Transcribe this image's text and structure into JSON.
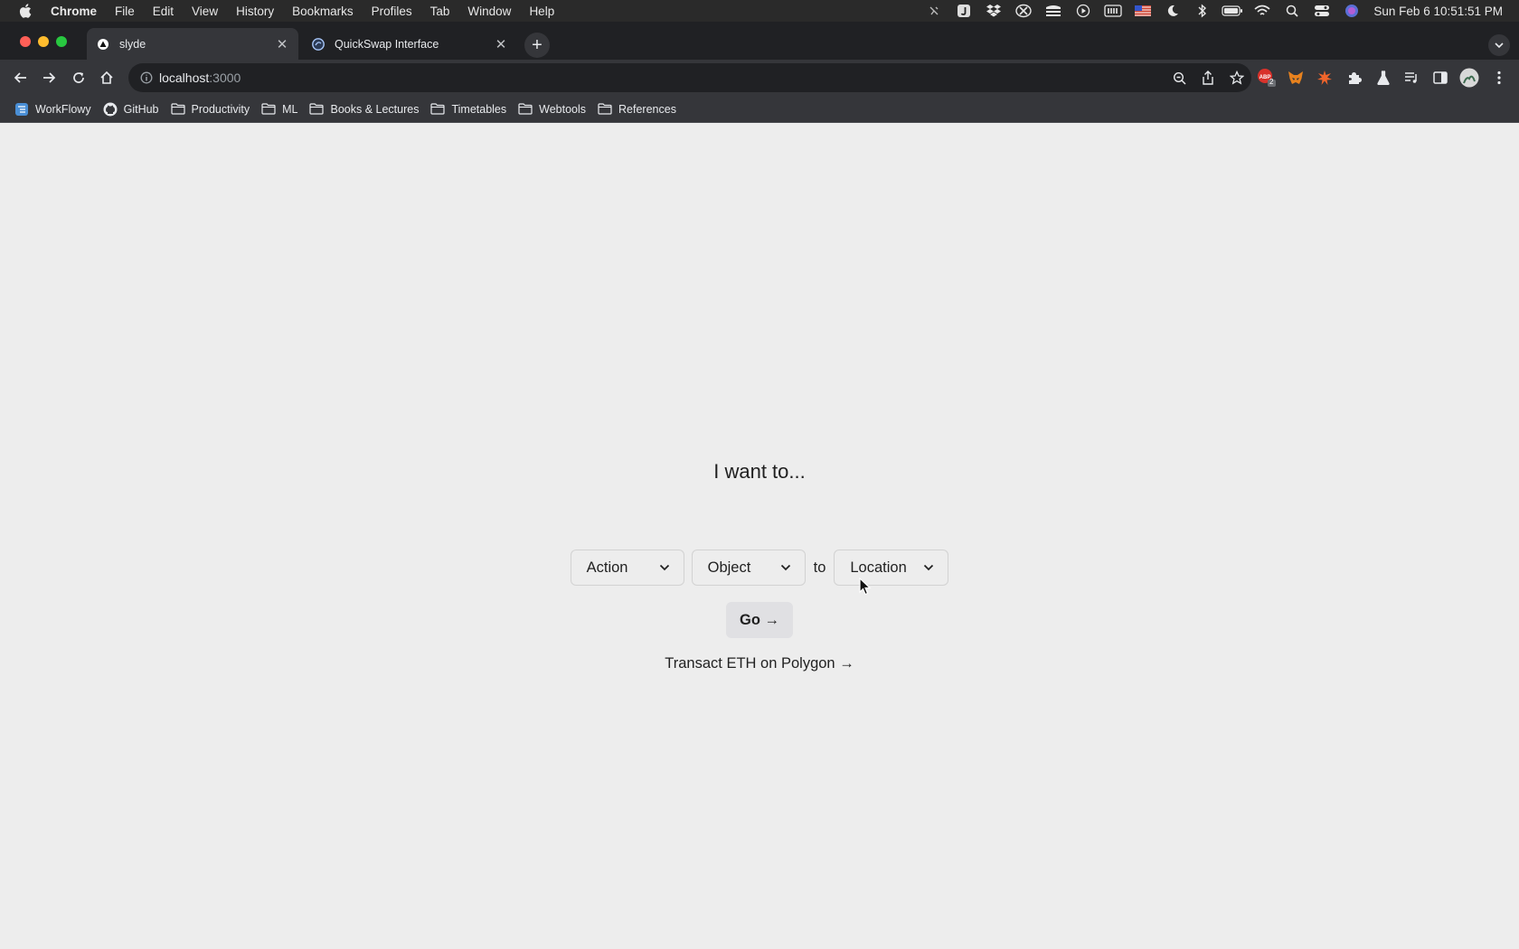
{
  "menubar": {
    "app": "Chrome",
    "items": [
      "File",
      "Edit",
      "View",
      "History",
      "Bookmarks",
      "Profiles",
      "Tab",
      "Window",
      "Help"
    ],
    "clock": "Sun Feb 6  10:51:51 PM",
    "tray_icons": [
      "mute-icon",
      "j-app-icon",
      "dropbox-icon",
      "x-circle-icon",
      "stack-icon",
      "play-icon",
      "battery-meter-icon",
      "us-flag-icon",
      "moon-icon",
      "bluetooth-icon",
      "battery-icon",
      "wifi-icon",
      "spotlight-search-icon",
      "control-center-icon",
      "siri-icon"
    ]
  },
  "tabs": [
    {
      "title": "slyde",
      "favicon": "triangle-favicon-icon",
      "active": true
    },
    {
      "title": "QuickSwap Interface",
      "favicon": "quickswap-favicon-icon",
      "active": false
    }
  ],
  "toolbar": {
    "url_host": "localhost",
    "url_port": ":3000",
    "extension_badge": "2"
  },
  "bookmarks": [
    {
      "label": "WorkFlowy",
      "icon": "workflowy-icon"
    },
    {
      "label": "GitHub",
      "icon": "github-icon"
    },
    {
      "label": "Productivity",
      "icon": "folder-icon"
    },
    {
      "label": "ML",
      "icon": "folder-icon"
    },
    {
      "label": "Books & Lectures",
      "icon": "folder-icon"
    },
    {
      "label": "Timetables",
      "icon": "folder-icon"
    },
    {
      "label": "Webtools",
      "icon": "folder-icon"
    },
    {
      "label": "References",
      "icon": "folder-icon"
    }
  ],
  "page": {
    "heading": "I want to...",
    "action_select": "Action",
    "object_select": "Object",
    "to_label": "to",
    "location_select": "Location",
    "go_button": "Go →",
    "transact_link": "Transact ETH on Polygon →"
  },
  "colors": {
    "page_bg": "#ededed",
    "chrome_dark": "#202124",
    "chrome_toolbar": "#35363a",
    "go_button_bg": "#e0e0e3"
  }
}
